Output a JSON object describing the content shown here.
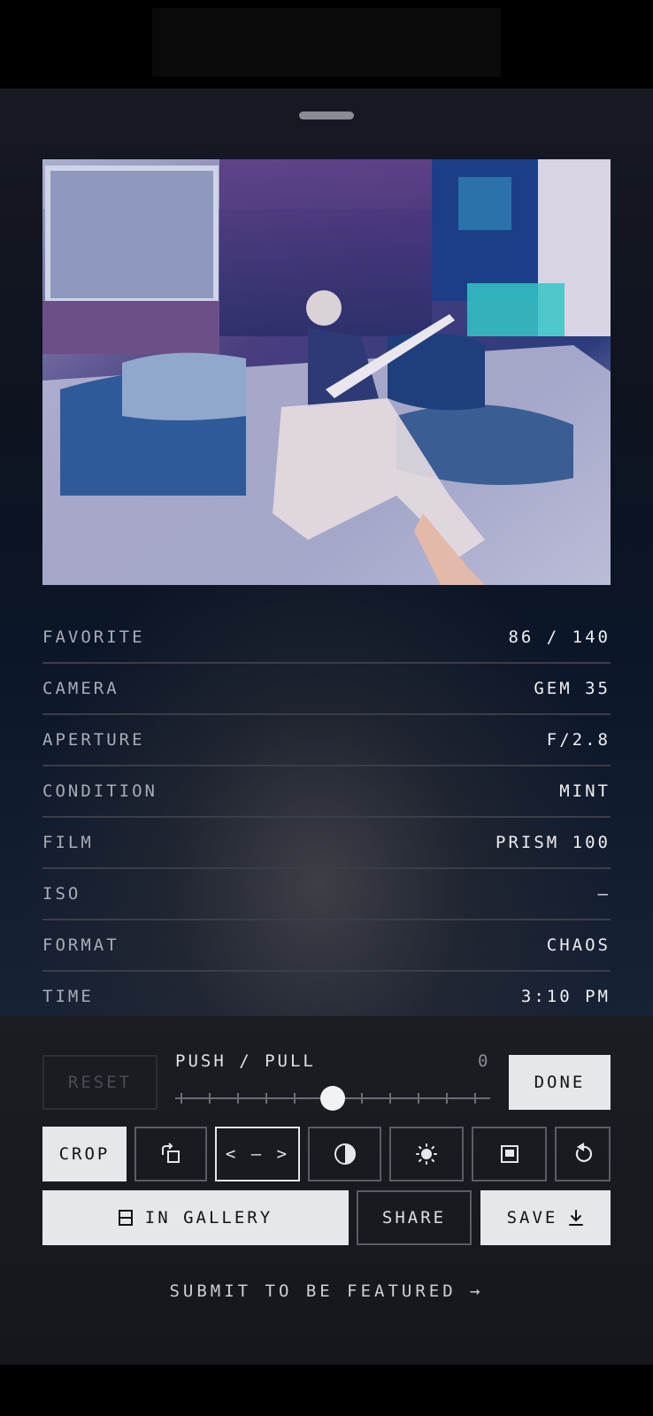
{
  "stats": [
    {
      "label": "FAVORITE",
      "value": "86 / 140"
    },
    {
      "label": "CAMERA",
      "value": "GEM 35"
    },
    {
      "label": "APERTURE",
      "value": "F/2.8"
    },
    {
      "label": "CONDITION",
      "value": "MINT"
    },
    {
      "label": "FILM",
      "value": "PRISM 100"
    },
    {
      "label": "ISO",
      "value": "—"
    },
    {
      "label": "FORMAT",
      "value": "CHAOS"
    },
    {
      "label": "TIME",
      "value": "3:10 PM"
    }
  ],
  "controls": {
    "reset_label": "RESET",
    "push_pull_label": "PUSH / PULL",
    "push_pull_value": "0",
    "push_pull_level": 0.5,
    "done_label": "DONE"
  },
  "tools": {
    "crop_label": "CROP",
    "arrows_label": "< — >"
  },
  "actions": {
    "gallery_label": "IN GALLERY",
    "share_label": "SHARE",
    "save_label": "SAVE"
  },
  "footer": {
    "featured_label": "SUBMIT TO BE FEATURED →"
  },
  "icons": {
    "rotate": "rotate-icon",
    "contrast": "contrast-icon",
    "brightness": "brightness-icon",
    "frame": "frame-icon",
    "undo": "undo-icon",
    "gallery": "gallery-icon",
    "download": "download-icon"
  }
}
